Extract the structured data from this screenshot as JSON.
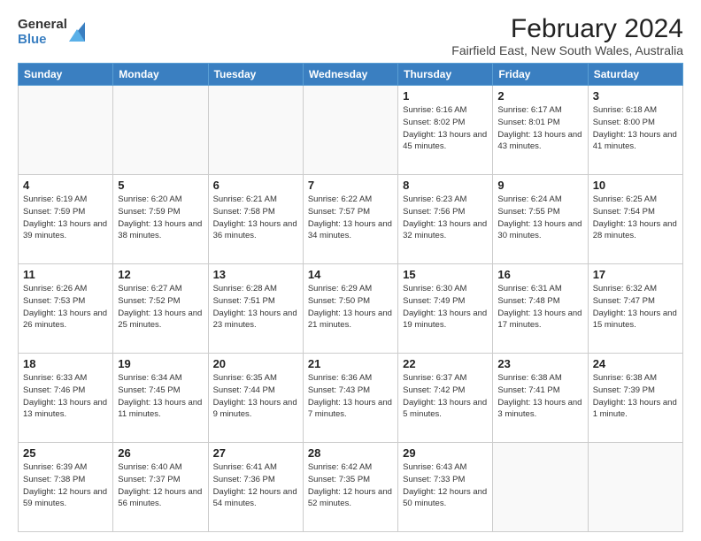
{
  "logo": {
    "general": "General",
    "blue": "Blue"
  },
  "title": "February 2024",
  "subtitle": "Fairfield East, New South Wales, Australia",
  "headers": [
    "Sunday",
    "Monday",
    "Tuesday",
    "Wednesday",
    "Thursday",
    "Friday",
    "Saturday"
  ],
  "weeks": [
    [
      {
        "num": "",
        "info": ""
      },
      {
        "num": "",
        "info": ""
      },
      {
        "num": "",
        "info": ""
      },
      {
        "num": "",
        "info": ""
      },
      {
        "num": "1",
        "info": "Sunrise: 6:16 AM\nSunset: 8:02 PM\nDaylight: 13 hours\nand 45 minutes."
      },
      {
        "num": "2",
        "info": "Sunrise: 6:17 AM\nSunset: 8:01 PM\nDaylight: 13 hours\nand 43 minutes."
      },
      {
        "num": "3",
        "info": "Sunrise: 6:18 AM\nSunset: 8:00 PM\nDaylight: 13 hours\nand 41 minutes."
      }
    ],
    [
      {
        "num": "4",
        "info": "Sunrise: 6:19 AM\nSunset: 7:59 PM\nDaylight: 13 hours\nand 39 minutes."
      },
      {
        "num": "5",
        "info": "Sunrise: 6:20 AM\nSunset: 7:59 PM\nDaylight: 13 hours\nand 38 minutes."
      },
      {
        "num": "6",
        "info": "Sunrise: 6:21 AM\nSunset: 7:58 PM\nDaylight: 13 hours\nand 36 minutes."
      },
      {
        "num": "7",
        "info": "Sunrise: 6:22 AM\nSunset: 7:57 PM\nDaylight: 13 hours\nand 34 minutes."
      },
      {
        "num": "8",
        "info": "Sunrise: 6:23 AM\nSunset: 7:56 PM\nDaylight: 13 hours\nand 32 minutes."
      },
      {
        "num": "9",
        "info": "Sunrise: 6:24 AM\nSunset: 7:55 PM\nDaylight: 13 hours\nand 30 minutes."
      },
      {
        "num": "10",
        "info": "Sunrise: 6:25 AM\nSunset: 7:54 PM\nDaylight: 13 hours\nand 28 minutes."
      }
    ],
    [
      {
        "num": "11",
        "info": "Sunrise: 6:26 AM\nSunset: 7:53 PM\nDaylight: 13 hours\nand 26 minutes."
      },
      {
        "num": "12",
        "info": "Sunrise: 6:27 AM\nSunset: 7:52 PM\nDaylight: 13 hours\nand 25 minutes."
      },
      {
        "num": "13",
        "info": "Sunrise: 6:28 AM\nSunset: 7:51 PM\nDaylight: 13 hours\nand 23 minutes."
      },
      {
        "num": "14",
        "info": "Sunrise: 6:29 AM\nSunset: 7:50 PM\nDaylight: 13 hours\nand 21 minutes."
      },
      {
        "num": "15",
        "info": "Sunrise: 6:30 AM\nSunset: 7:49 PM\nDaylight: 13 hours\nand 19 minutes."
      },
      {
        "num": "16",
        "info": "Sunrise: 6:31 AM\nSunset: 7:48 PM\nDaylight: 13 hours\nand 17 minutes."
      },
      {
        "num": "17",
        "info": "Sunrise: 6:32 AM\nSunset: 7:47 PM\nDaylight: 13 hours\nand 15 minutes."
      }
    ],
    [
      {
        "num": "18",
        "info": "Sunrise: 6:33 AM\nSunset: 7:46 PM\nDaylight: 13 hours\nand 13 minutes."
      },
      {
        "num": "19",
        "info": "Sunrise: 6:34 AM\nSunset: 7:45 PM\nDaylight: 13 hours\nand 11 minutes."
      },
      {
        "num": "20",
        "info": "Sunrise: 6:35 AM\nSunset: 7:44 PM\nDaylight: 13 hours\nand 9 minutes."
      },
      {
        "num": "21",
        "info": "Sunrise: 6:36 AM\nSunset: 7:43 PM\nDaylight: 13 hours\nand 7 minutes."
      },
      {
        "num": "22",
        "info": "Sunrise: 6:37 AM\nSunset: 7:42 PM\nDaylight: 13 hours\nand 5 minutes."
      },
      {
        "num": "23",
        "info": "Sunrise: 6:38 AM\nSunset: 7:41 PM\nDaylight: 13 hours\nand 3 minutes."
      },
      {
        "num": "24",
        "info": "Sunrise: 6:38 AM\nSunset: 7:39 PM\nDaylight: 13 hours\nand 1 minute."
      }
    ],
    [
      {
        "num": "25",
        "info": "Sunrise: 6:39 AM\nSunset: 7:38 PM\nDaylight: 12 hours\nand 59 minutes."
      },
      {
        "num": "26",
        "info": "Sunrise: 6:40 AM\nSunset: 7:37 PM\nDaylight: 12 hours\nand 56 minutes."
      },
      {
        "num": "27",
        "info": "Sunrise: 6:41 AM\nSunset: 7:36 PM\nDaylight: 12 hours\nand 54 minutes."
      },
      {
        "num": "28",
        "info": "Sunrise: 6:42 AM\nSunset: 7:35 PM\nDaylight: 12 hours\nand 52 minutes."
      },
      {
        "num": "29",
        "info": "Sunrise: 6:43 AM\nSunset: 7:33 PM\nDaylight: 12 hours\nand 50 minutes."
      },
      {
        "num": "",
        "info": ""
      },
      {
        "num": "",
        "info": ""
      }
    ]
  ]
}
